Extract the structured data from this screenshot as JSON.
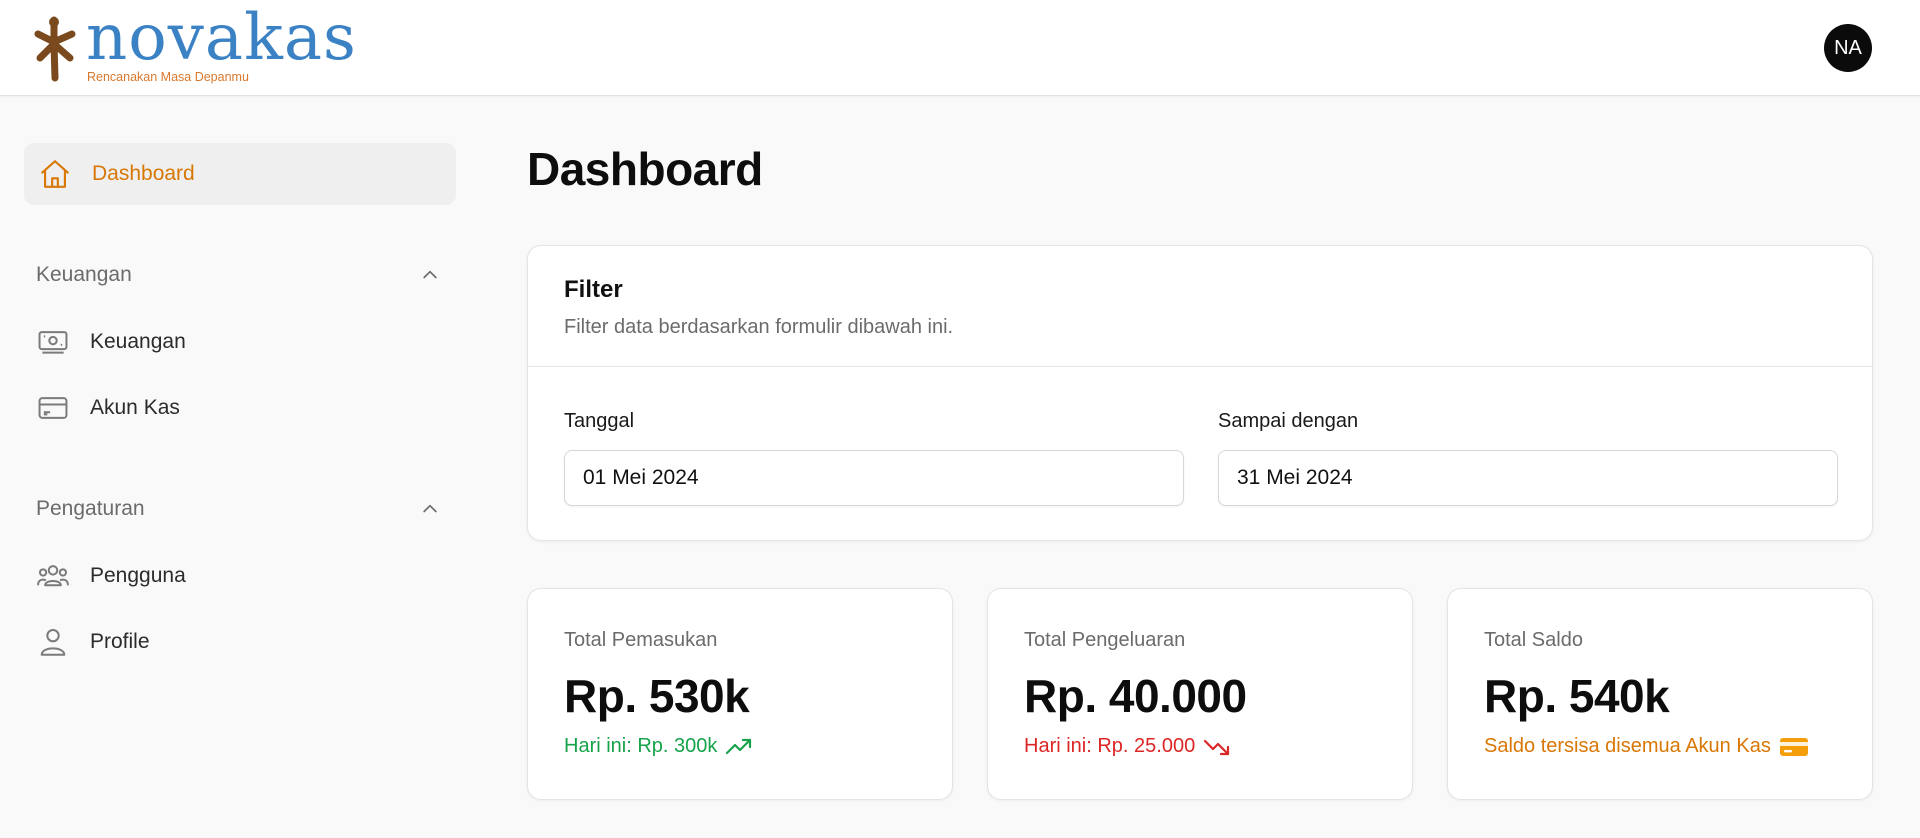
{
  "header": {
    "logo_text": "novakas",
    "logo_tagline": "Rencanakan Masa Depanmu",
    "avatar_initials": "NA"
  },
  "sidebar": {
    "dashboard": {
      "label": "Dashboard",
      "icon": "home-icon"
    },
    "sections": [
      {
        "title": "Keuangan",
        "items": [
          {
            "label": "Keuangan",
            "icon": "cash-icon"
          },
          {
            "label": "Akun Kas",
            "icon": "credit-card-icon"
          }
        ]
      },
      {
        "title": "Pengaturan",
        "items": [
          {
            "label": "Pengguna",
            "icon": "users-icon"
          },
          {
            "label": "Profile",
            "icon": "user-icon"
          }
        ]
      }
    ]
  },
  "main": {
    "title": "Dashboard",
    "filter": {
      "title": "Filter",
      "subtitle": "Filter data berdasarkan formulir dibawah ini.",
      "from_label": "Tanggal",
      "from_value": "01 Mei 2024",
      "to_label": "Sampai dengan",
      "to_value": "31 Mei 2024"
    },
    "stats": [
      {
        "label": "Total Pemasukan",
        "value": "Rp. 530k",
        "note": "Hari ini: Rp. 300k",
        "note_color": "#16a34a",
        "icon": "trending-up-icon"
      },
      {
        "label": "Total Pengeluaran",
        "value": "Rp. 40.000",
        "note": "Hari ini: Rp. 25.000",
        "note_color": "#dc2626",
        "icon": "trending-down-icon"
      },
      {
        "label": "Total Saldo",
        "value": "Rp. 540k",
        "note": "Saldo tersisa disemua Akun Kas",
        "note_color": "#d97706",
        "icon": "credit-card-icon"
      }
    ]
  },
  "colors": {
    "accent": "#d97706",
    "brand_blue": "#3b82c4",
    "positive": "#16a34a",
    "negative": "#dc2626"
  }
}
